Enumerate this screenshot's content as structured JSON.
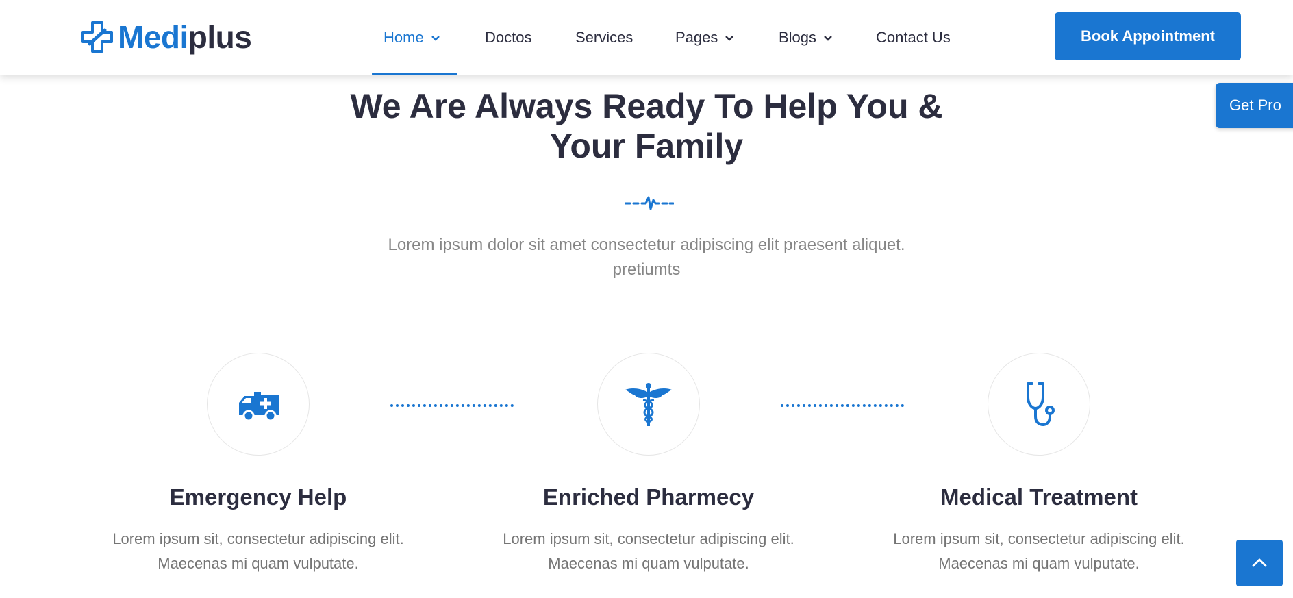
{
  "header": {
    "logo_part1": "Medi",
    "logo_part2": "plus",
    "nav": [
      {
        "label": "Home",
        "dropdown": true,
        "active": true
      },
      {
        "label": "Doctos",
        "dropdown": false
      },
      {
        "label": "Services",
        "dropdown": false
      },
      {
        "label": "Pages",
        "dropdown": true
      },
      {
        "label": "Blogs",
        "dropdown": true
      },
      {
        "label": "Contact Us",
        "dropdown": false
      }
    ],
    "cta_label": "Book Appointment"
  },
  "floating": {
    "get_pro_label": "Get Pro",
    "scroll_top_icon": "chevron-up-icon"
  },
  "section": {
    "title_line1": "We Are Always Ready To Help You &",
    "title_line2": "Your Family",
    "divider_icon": "heartbeat-icon",
    "desc_line1": "Lorem ipsum dolor sit amet consectetur adipiscing elit praesent aliquet.",
    "desc_line2": "pretiumts"
  },
  "features": [
    {
      "icon": "ambulance-icon",
      "title": "Emergency Help",
      "desc_line1": "Lorem ipsum sit, consectetur adipiscing elit.",
      "desc_line2": "Maecenas mi quam vulputate."
    },
    {
      "icon": "caduceus-icon",
      "title": "Enriched Pharmecy",
      "desc_line1": "Lorem ipsum sit, consectetur adipiscing elit.",
      "desc_line2": "Maecenas mi quam vulputate."
    },
    {
      "icon": "stethoscope-icon",
      "title": "Medical Treatment",
      "desc_line1": "Lorem ipsum sit, consectetur adipiscing elit.",
      "desc_line2": "Maecenas mi quam vulputate."
    }
  ],
  "colors": {
    "accent": "#1a76d1",
    "heading": "#2c2d3f",
    "body_text": "#757575"
  }
}
